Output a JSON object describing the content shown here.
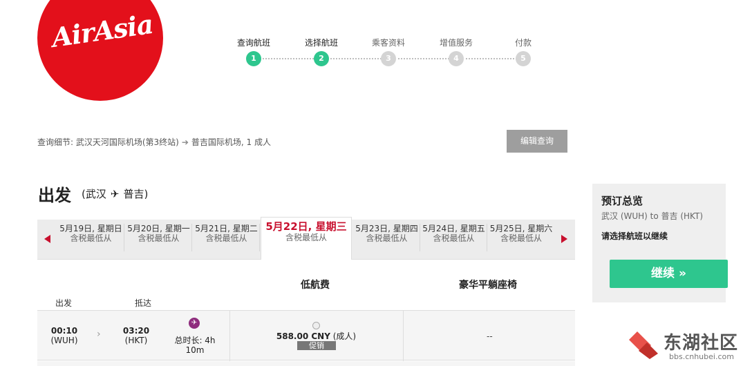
{
  "brand": {
    "logo_text": "AirAsia",
    "color": "#e3101b"
  },
  "steps": [
    {
      "label": "查询航班",
      "number": "1",
      "state": "done"
    },
    {
      "label": "选择航班",
      "number": "2",
      "state": "active"
    },
    {
      "label": "乘客资料",
      "number": "3",
      "state": "pending"
    },
    {
      "label": "增值服务",
      "number": "4",
      "state": "pending"
    },
    {
      "label": "付款",
      "number": "5",
      "state": "pending"
    }
  ],
  "search": {
    "prefix": "查询细节: 武汉天河国际机场(第3终站)",
    "suffix": "普吉国际机场, 1 成人",
    "edit_label": "编辑查询"
  },
  "departure": {
    "title": "出发",
    "origin": "(武汉",
    "destination": "普吉)",
    "plane_icon": "airplane-icon"
  },
  "date_tabs": [
    {
      "date": "5月19日, 星期日",
      "sub": "含税最低从"
    },
    {
      "date": "5月20日, 星期一",
      "sub": "含税最低从"
    },
    {
      "date": "5月21日, 星期二",
      "sub": "含税最低从"
    },
    {
      "date": "5月22日, 星期三",
      "sub": "含税最低从",
      "selected": true
    },
    {
      "date": "5月23日, 星期四",
      "sub": "含税最低从"
    },
    {
      "date": "5月24日, 星期五",
      "sub": "含税最低从"
    },
    {
      "date": "5月25日, 星期六",
      "sub": "含税最低从"
    }
  ],
  "fare_table": {
    "col_low": "低航费",
    "col_premium": "豪华平躺座椅",
    "col_depart": "出发",
    "col_arrive": "抵达"
  },
  "flight": {
    "depart_time": "00:10",
    "depart_code": "(WUH)",
    "arrive_time": "03:20",
    "arrive_code": "(HKT)",
    "duration_line1": "总时长: 4h",
    "duration_line2": "10m",
    "price_value": "588.00 CNY",
    "price_suffix": "(成人)",
    "promo": "促销",
    "premium_value": "--"
  },
  "summary": {
    "title": "预订总览",
    "route": "武汉 (WUH) to 普吉 (HKT)",
    "note": "请选择航班以继续",
    "continue_label": "继续 »"
  },
  "watermark": {
    "text": "东湖社区",
    "url": "bbs.cnhubei.com"
  },
  "colors": {
    "accent": "#2ec68e",
    "red": "#c8102e",
    "gray_button": "#9e9e9e"
  }
}
